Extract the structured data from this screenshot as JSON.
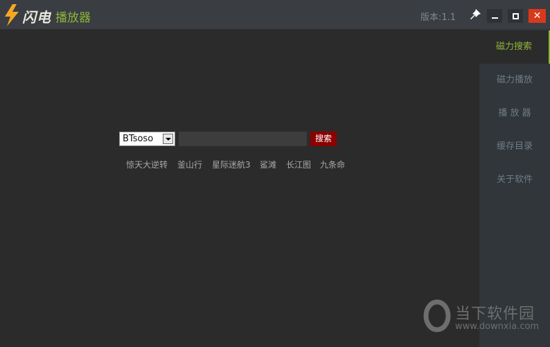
{
  "titlebar": {
    "brand": "闪电",
    "subtitle": "播放器",
    "version": "版本:1.1",
    "close_glyph": "✕"
  },
  "icons": {
    "logo": "lightning-bolt-icon",
    "pin": "pin-icon",
    "minimize": "minimize-icon",
    "maximize": "maximize-icon",
    "close": "close-icon"
  },
  "colors": {
    "accent": "#8fb43a",
    "close": "#d9391b",
    "search_button": "#8b0000"
  },
  "sidebar": {
    "items": [
      {
        "label": "磁力搜索",
        "active": true
      },
      {
        "label": "磁力播放",
        "active": false
      },
      {
        "label": "播 放 器",
        "active": false
      },
      {
        "label": "缓存目录",
        "active": false
      },
      {
        "label": "关于软件",
        "active": false
      }
    ]
  },
  "search": {
    "engine": "BTsoso",
    "query": "",
    "button": "搜索",
    "hot": [
      "惊天大逆转",
      "釜山行",
      "星际迷航3",
      "鲨滩",
      "长江图",
      "九条命"
    ]
  },
  "watermark": {
    "name": "当下软件园",
    "url": "www.downxia.com"
  }
}
